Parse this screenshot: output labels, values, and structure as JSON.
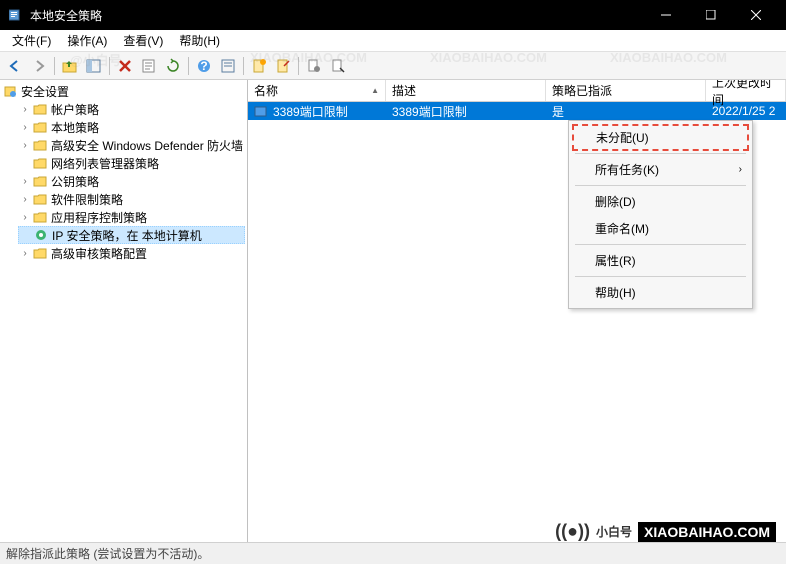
{
  "window": {
    "title": "本地安全策略"
  },
  "menubar": {
    "file": "文件(F)",
    "action": "操作(A)",
    "view": "查看(V)",
    "help": "帮助(H)"
  },
  "tree": {
    "root": "安全设置",
    "children": [
      {
        "label": "帐户策略"
      },
      {
        "label": "本地策略"
      },
      {
        "label": "高级安全 Windows Defender 防火墙"
      },
      {
        "label": "网络列表管理器策略"
      },
      {
        "label": "公钥策略"
      },
      {
        "label": "软件限制策略"
      },
      {
        "label": "应用程序控制策略"
      },
      {
        "label": "IP 安全策略，在 本地计算机",
        "selected": true,
        "icon": "ipsec"
      },
      {
        "label": "高级审核策略配置"
      }
    ]
  },
  "listHeader": {
    "name": "名称",
    "desc": "描述",
    "assigned": "策略已指派",
    "date": "上次更改时间"
  },
  "listRows": [
    {
      "name": "3389端口限制",
      "desc": "3389端口限制",
      "assigned": "是",
      "date": "2022/1/25 2"
    }
  ],
  "contextMenu": {
    "unassign": "未分配(U)",
    "allTasks": "所有任务(K)",
    "delete": "删除(D)",
    "rename": "重命名(M)",
    "properties": "属性(R)",
    "help": "帮助(H)"
  },
  "statusbar": {
    "text": "解除指派此策略 (尝试设置为不活动)。"
  },
  "brand": {
    "name": "小白号",
    "domain": "XIAOBAIHAO.COM"
  }
}
